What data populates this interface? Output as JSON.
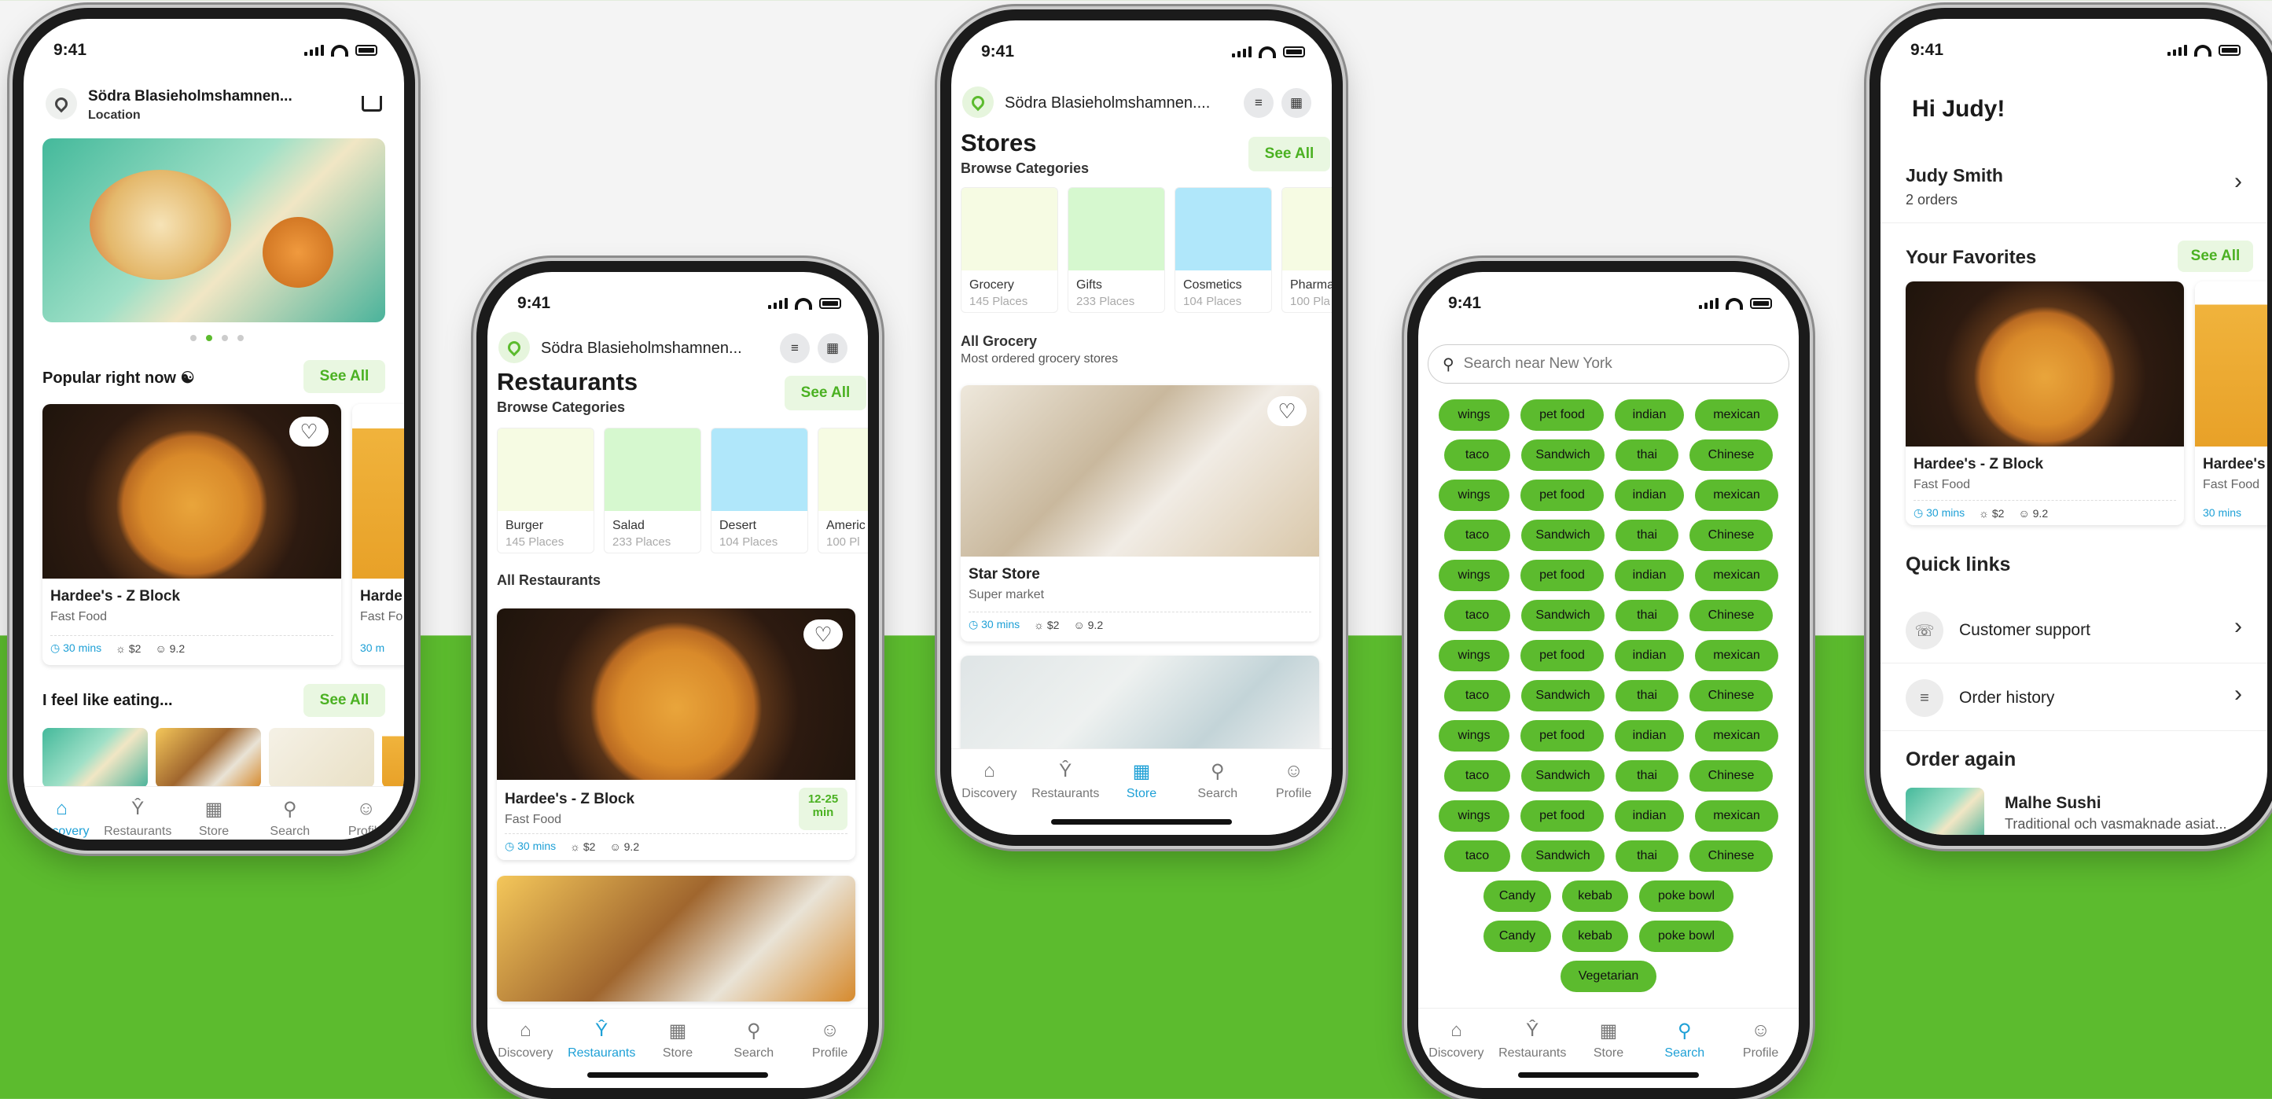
{
  "status_time": "9:41",
  "colors": {
    "brand_green": "#5cbb2e",
    "active_blue": "#1ea0d6"
  },
  "nav": [
    "Discovery",
    "Restaurants",
    "Store",
    "Search",
    "Profile"
  ],
  "nav_icons": [
    "home-icon",
    "utensils-icon",
    "store-icon",
    "search-icon",
    "profile-icon"
  ],
  "location": "Södra Blasieholmshamnen...",
  "location_short": "Södra Blasieholmshamnen....",
  "discovery": {
    "location_label": "Location",
    "popular_title": "Popular right now",
    "see_all": "See All",
    "card": {
      "name": "Hardee's - Z Block",
      "type": "Fast Food",
      "time": "30 mins",
      "price": "$2",
      "rating": "9.2"
    },
    "card2_name": "Harde",
    "card2_type": "Fast Fo",
    "card2_time": "30 m",
    "eating_title": "I feel like eating..."
  },
  "restaurants": {
    "title": "Restaurants",
    "browse": "Browse Categories",
    "see_all": "See All",
    "categories": [
      {
        "name": "Burger",
        "places": "145 Places"
      },
      {
        "name": "Salad",
        "places": "233 Places"
      },
      {
        "name": "Desert",
        "places": "104 Places"
      },
      {
        "name": "Americ",
        "places": "100 Pl"
      }
    ],
    "all_title": "All Restaurants",
    "card": {
      "name": "Hardee's - Z Block",
      "type": "Fast Food",
      "eta1": "12-25",
      "eta2": "min",
      "time": "30 mins",
      "price": "$2",
      "rating": "9.2"
    }
  },
  "stores": {
    "title": "Stores",
    "browse": "Browse Categories",
    "see_all": "See All",
    "categories": [
      {
        "name": "Grocery",
        "places": "145 Places"
      },
      {
        "name": "Gifts",
        "places": "233 Places"
      },
      {
        "name": "Cosmetics",
        "places": "104 Places"
      },
      {
        "name": "Pharma",
        "places": "100 Pla"
      }
    ],
    "all_title": "All Grocery",
    "all_sub": "Most ordered grocery stores",
    "card": {
      "name": "Star Store",
      "type": "Super market",
      "time": "30 mins",
      "price": "$2",
      "rating": "9.2"
    }
  },
  "search": {
    "placeholder": "Search near New York",
    "rows": [
      [
        "wings",
        "pet food",
        "indian",
        "mexican"
      ],
      [
        "taco",
        "Sandwich",
        "thai",
        "Chinese"
      ],
      [
        "wings",
        "pet food",
        "indian",
        "mexican"
      ],
      [
        "taco",
        "Sandwich",
        "thai",
        "Chinese"
      ],
      [
        "wings",
        "pet food",
        "indian",
        "mexican"
      ],
      [
        "taco",
        "Sandwich",
        "thai",
        "Chinese"
      ],
      [
        "wings",
        "pet food",
        "indian",
        "mexican"
      ],
      [
        "taco",
        "Sandwich",
        "thai",
        "Chinese"
      ],
      [
        "wings",
        "pet food",
        "indian",
        "mexican"
      ],
      [
        "taco",
        "Sandwich",
        "thai",
        "Chinese"
      ],
      [
        "wings",
        "pet food",
        "indian",
        "mexican"
      ],
      [
        "taco",
        "Sandwich",
        "thai",
        "Chinese"
      ],
      [
        "Candy",
        "kebab",
        "poke bowl"
      ],
      [
        "Candy",
        "kebab",
        "poke bowl"
      ],
      [
        "Vegetarian"
      ]
    ]
  },
  "profile": {
    "greeting": "Hi Judy!",
    "name": "Judy Smith",
    "orders": "2 orders",
    "favorites_title": "Your Favorites",
    "see_all": "See All",
    "fav": {
      "name": "Hardee's - Z Block",
      "type": "Fast Food",
      "time": "30 mins",
      "price": "$2",
      "rating": "9.2"
    },
    "fav2_name": "Hardee's -",
    "fav2_type": "Fast Food",
    "fav2_time": "30 mins",
    "quick_links_title": "Quick links",
    "links": [
      "Customer support",
      "Order history"
    ],
    "order_again_title": "Order again",
    "restaurant_name": "Malhe Sushi",
    "restaurant_desc": "Traditional och vasmaknade asiat..."
  }
}
